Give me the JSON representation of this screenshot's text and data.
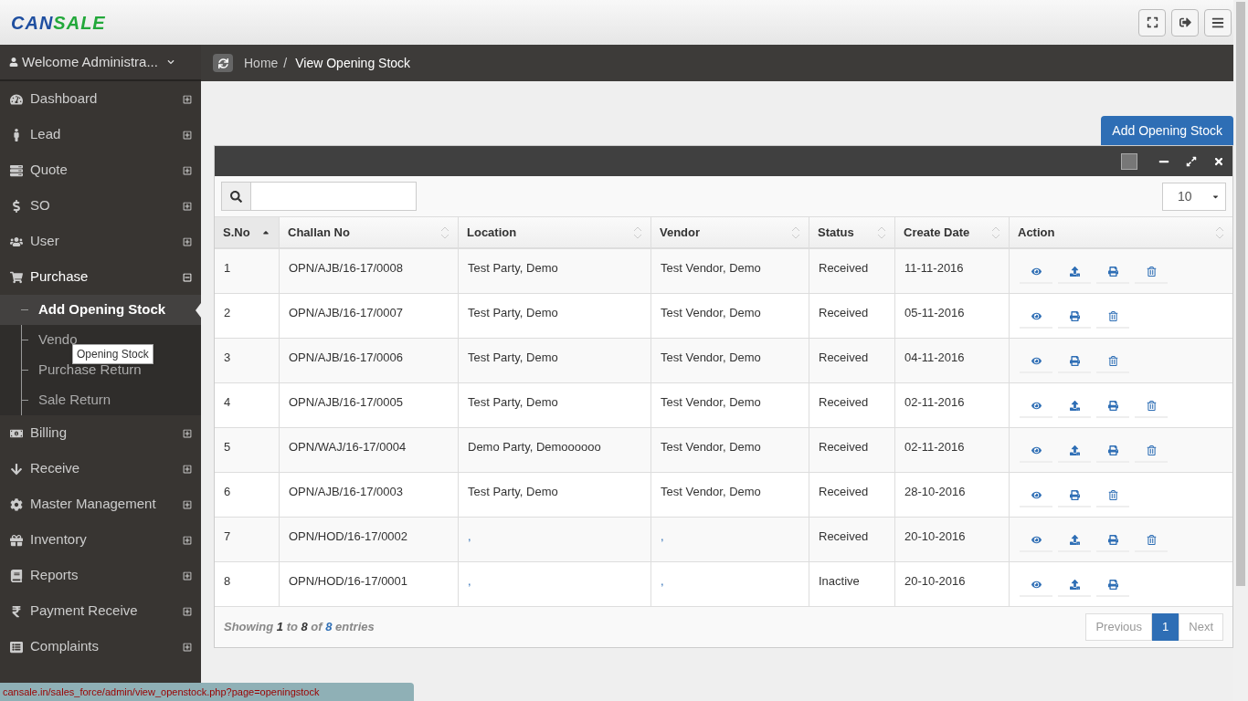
{
  "header": {
    "logo": [
      "CAN",
      "SALE"
    ]
  },
  "sidebar": {
    "user": "Welcome Administra...",
    "items": [
      {
        "label": "Dashboard",
        "expanded": false
      },
      {
        "label": "Lead",
        "expanded": false
      },
      {
        "label": "Quote",
        "expanded": false
      },
      {
        "label": "SO",
        "expanded": false
      },
      {
        "label": "User",
        "expanded": false
      },
      {
        "label": "Purchase",
        "expanded": true,
        "children": [
          {
            "label": "Add Opening Stock",
            "selected": true
          },
          {
            "label": "Vendo",
            "selected": false
          },
          {
            "label": "Purchase Return",
            "selected": false
          },
          {
            "label": "Sale Return",
            "selected": false
          }
        ]
      },
      {
        "label": "Billing",
        "expanded": false
      },
      {
        "label": "Receive",
        "expanded": false
      },
      {
        "label": "Master Management",
        "expanded": false
      },
      {
        "label": "Inventory",
        "expanded": false
      },
      {
        "label": "Reports",
        "expanded": false
      },
      {
        "label": "Payment Receive",
        "expanded": false
      },
      {
        "label": "Complaints",
        "expanded": false
      }
    ],
    "tooltip": "Opening Stock"
  },
  "breadcrumb": {
    "links": [
      "Home"
    ],
    "separator": "/",
    "current": "View Opening Stock"
  },
  "add_button": "Add Opening Stock",
  "page_size": "10",
  "table": {
    "columns": [
      {
        "label": "S.No",
        "sorted": true
      },
      {
        "label": "Challan No",
        "sorted": false
      },
      {
        "label": "Location",
        "sorted": false
      },
      {
        "label": "Vendor",
        "sorted": false
      },
      {
        "label": "Status",
        "sorted": false
      },
      {
        "label": "Create Date",
        "sorted": false
      },
      {
        "label": "Action",
        "sorted": false
      }
    ],
    "rows": [
      {
        "cells": [
          "1",
          "OPN/AJB/16-17/0008",
          "Test Party, Demo",
          "Test Vendor, Demo",
          "Received",
          "11-11-2016"
        ],
        "actions": [
          {
            "kind": "view"
          },
          {
            "kind": "upload"
          },
          {
            "kind": "print"
          },
          {
            "kind": "delete"
          }
        ]
      },
      {
        "cells": [
          "2",
          "OPN/AJB/16-17/0007",
          "Test Party, Demo",
          "Test Vendor, Demo",
          "Received",
          "05-11-2016"
        ],
        "actions": [
          {
            "kind": "view"
          },
          {
            "kind": "print"
          },
          {
            "kind": "delete"
          }
        ]
      },
      {
        "cells": [
          "3",
          "OPN/AJB/16-17/0006",
          "Test Party, Demo",
          "Test Vendor, Demo",
          "Received",
          "04-11-2016"
        ],
        "actions": [
          {
            "kind": "view"
          },
          {
            "kind": "print"
          },
          {
            "kind": "delete"
          }
        ]
      },
      {
        "cells": [
          "4",
          "OPN/AJB/16-17/0005",
          "Test Party, Demo",
          "Test Vendor, Demo",
          "Received",
          "02-11-2016"
        ],
        "actions": [
          {
            "kind": "view"
          },
          {
            "kind": "upload"
          },
          {
            "kind": "print"
          },
          {
            "kind": "delete"
          }
        ]
      },
      {
        "cells": [
          "5",
          "OPN/WAJ/16-17/0004",
          "Demo Party, Demoooooo",
          "Test Vendor, Demo",
          "Received",
          "02-11-2016"
        ],
        "actions": [
          {
            "kind": "view"
          },
          {
            "kind": "upload"
          },
          {
            "kind": "print"
          },
          {
            "kind": "delete"
          }
        ]
      },
      {
        "cells": [
          "6",
          "OPN/AJB/16-17/0003",
          "Test Party, Demo",
          "Test Vendor, Demo",
          "Received",
          "28-10-2016"
        ],
        "actions": [
          {
            "kind": "view"
          },
          {
            "kind": "print"
          },
          {
            "kind": "delete"
          }
        ]
      },
      {
        "cells": [
          "7",
          "OPN/HOD/16-17/0002",
          ",",
          ",",
          "Received",
          "20-10-2016"
        ],
        "actions": [
          {
            "kind": "view"
          },
          {
            "kind": "upload"
          },
          {
            "kind": "print"
          },
          {
            "kind": "delete"
          }
        ]
      },
      {
        "cells": [
          "8",
          "OPN/HOD/16-17/0001",
          ",",
          ",",
          "Inactive",
          "20-10-2016"
        ],
        "actions": [
          {
            "kind": "view"
          },
          {
            "kind": "upload"
          },
          {
            "kind": "print"
          }
        ]
      }
    ]
  },
  "info": "Showing **1** to **8** of **8** entries",
  "pagination": [
    {
      "label": "Previous",
      "selected": false
    },
    {
      "label": "1",
      "selected": true
    },
    {
      "label": "Next",
      "selected": false
    }
  ],
  "status_url": "cansale.in/sales_force/admin/view_openstock.php?page=openingstock"
}
